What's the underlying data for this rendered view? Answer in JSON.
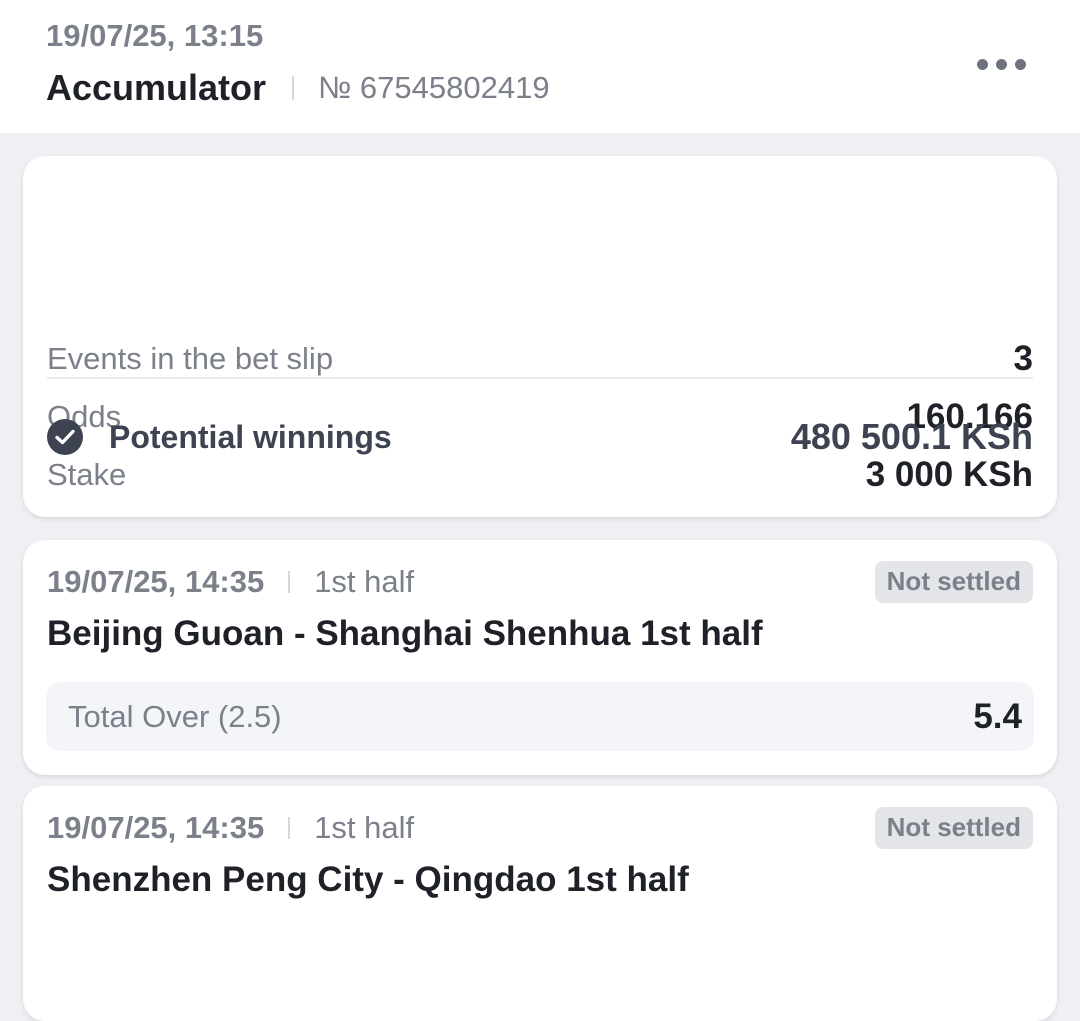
{
  "header": {
    "datetime": "19/07/25, 13:15",
    "bet_type": "Accumulator",
    "bet_number": "№ 67545802419",
    "menu_icon": "more-horizontal-icon"
  },
  "summary": {
    "events_label": "Events in the bet slip",
    "events_value": "3",
    "odds_label": "Odds",
    "odds_value": "160.166",
    "stake_label": "Stake",
    "stake_value": "3 000 KSh",
    "winnings_label": "Potential winnings",
    "winnings_value": "480 500.1 KSh",
    "winnings_icon": "check-circle-icon"
  },
  "events": [
    {
      "datetime": "19/07/25, 14:35",
      "period": "1st half",
      "status": "Not settled",
      "title": "Beijing Guoan - Shanghai Shenhua 1st half",
      "market": "Total Over (2.5)",
      "odds": "5.4"
    },
    {
      "datetime": "19/07/25, 14:35",
      "period": "1st half",
      "status": "Not settled",
      "title": "Shenzhen Peng City - Qingdao 1st half"
    }
  ],
  "colors": {
    "background": "#eef0f3",
    "card": "#ffffff",
    "text_primary": "#1e2127",
    "text_secondary": "#7b808a",
    "accent_dark": "#3d4350",
    "badge_bg": "#e3e5e8"
  }
}
